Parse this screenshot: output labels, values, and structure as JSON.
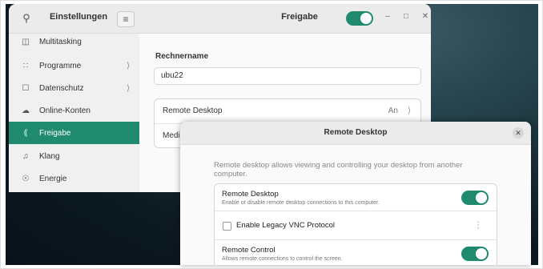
{
  "settings": {
    "sidebar_title": "Einstellungen",
    "sidebar_items": [
      {
        "icon": "multitasking-icon",
        "label": "Multitasking"
      },
      {
        "icon": "apps-grid-icon",
        "label": "Programme"
      },
      {
        "icon": "lock-icon",
        "label": "Datenschutz"
      },
      {
        "icon": "cloud-icon",
        "label": "Online-Konten"
      },
      {
        "icon": "share-icon",
        "label": "Freigabe"
      },
      {
        "icon": "music-note-icon",
        "label": "Klang"
      },
      {
        "icon": "power-icon",
        "label": "Energie"
      }
    ],
    "page_title": "Freigabe",
    "sharing_toggle_on": true,
    "hostname_label": "Rechnername",
    "hostname_value": "ubu22",
    "rows": [
      {
        "label": "Remote Desktop",
        "value": "An"
      },
      {
        "label": "Medi"
      }
    ]
  },
  "dialog": {
    "title": "Remote Desktop",
    "description": "Remote desktop allows viewing and controlling your desktop from another computer.",
    "rows": [
      {
        "title": "Remote Desktop",
        "subtitle": "Enable or disable remote desktop connections to this computer.",
        "on": true
      },
      {
        "title": "Enable Legacy VNC Protocol"
      },
      {
        "title": "Remote Control",
        "subtitle": "Allows remote connections to control the screen.",
        "on": true
      }
    ]
  },
  "colors": {
    "accent": "#1f8a6d"
  }
}
